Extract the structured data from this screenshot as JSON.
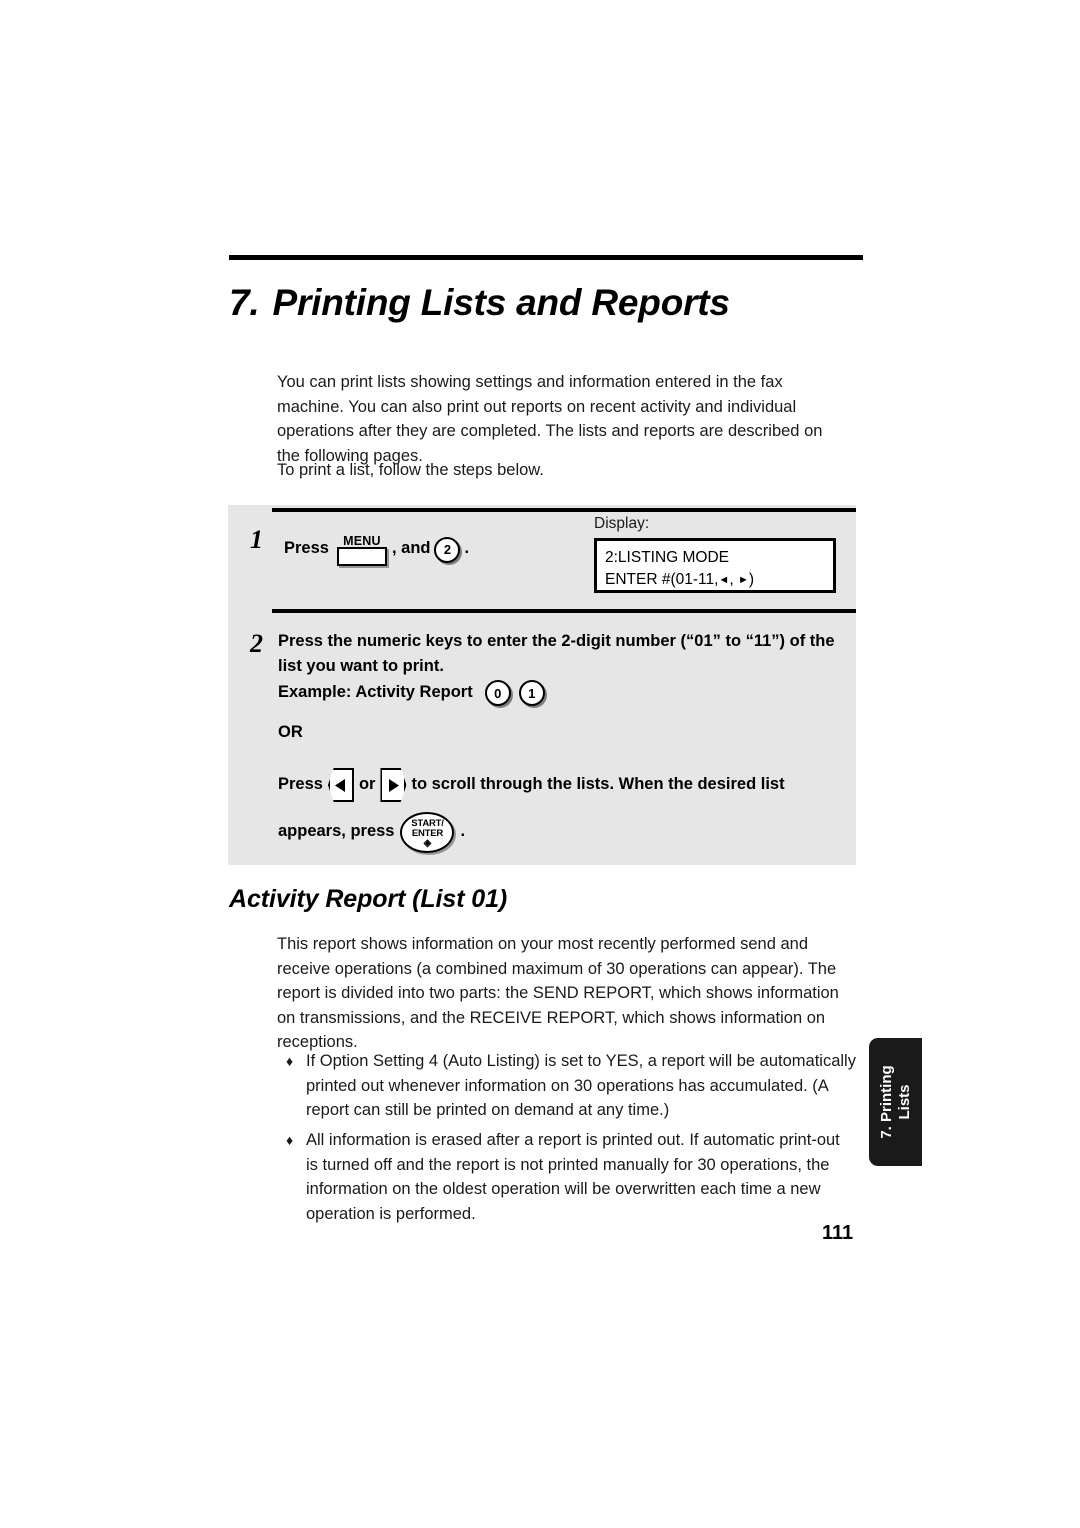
{
  "chapter": {
    "number": "7.",
    "title": "Printing Lists and Reports"
  },
  "intro": {
    "paragraph_1": "You can print lists showing settings and information entered in the fax machine. You can also print out reports on recent activity and individual operations after they are completed. The lists and reports are described on the following pages.",
    "paragraph_2": "To print a list, follow the steps below."
  },
  "procedure": {
    "step_1": {
      "number": "1",
      "text_before_key": "Press",
      "menu_key_label": "MENU",
      "text_between": ", and",
      "digit_key": "2",
      "text_after": ".",
      "display_label": "Display:",
      "display_line_1": "2:LISTING MODE",
      "display_line_2_prefix": "ENTER #(01-11,",
      "display_line_2_left_arrow": "◄",
      "display_line_2_comma": ",",
      "display_line_2_right_arrow": "►",
      "display_line_2_suffix": ")"
    },
    "step_2": {
      "number": "2",
      "instruction": "Press the numeric keys to enter the 2-digit number (“01” to “11”) of the list you want to print.",
      "example_label": "Example: Activity Report",
      "example_digit_1": "0",
      "example_digit_2": "1",
      "or_label": "OR",
      "scroll_text_before": "Press",
      "scroll_text_between": "or",
      "scroll_text_after": "to scroll through the lists. When the desired list",
      "enter_text_before": "appears, press",
      "enter_key_line_1": "START/",
      "enter_key_line_2": "ENTER",
      "enter_key_glyph": "◈",
      "enter_text_after": "."
    }
  },
  "section": {
    "heading": "Activity Report (List 01)",
    "paragraph": "This report shows information on your most recently performed send and receive operations (a combined maximum of 30 operations can appear). The report is divided into two parts: the SEND REPORT, which shows information on transmissions, and the RECEIVE REPORT, which shows information on receptions.",
    "bullet_mark": "♦",
    "bullets": [
      "If Option Setting 4 (Auto Listing) is set to YES, a report will be automatically printed out whenever information on 30 operations has accumulated. (A report can still be printed on demand at any time.)",
      "All information is erased after a report is printed out. If automatic print-out is turned off and the report is not printed manually for 30 operations, the information on the oldest operation will be overwritten each time a new operation is performed."
    ]
  },
  "side_tab": {
    "line_1": "7. Printing",
    "line_2": "Lists"
  },
  "page_number": "111",
  "colors": {
    "procedure_box_background": "#e6e6e6",
    "side_tab_background": "#1a1a1a",
    "text": "#000000"
  }
}
